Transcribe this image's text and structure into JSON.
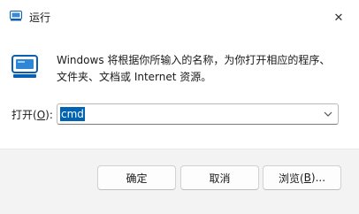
{
  "window": {
    "title": "运行",
    "icon": "run-dialog-icon"
  },
  "titlebar": {
    "close_glyph": "✕"
  },
  "content": {
    "description": "Windows 将根据你所输入的名称，为你打开相应的程序、文件夹、文档或 Internet 资源。",
    "open_label_prefix": "打开(",
    "open_label_key": "O",
    "open_label_suffix": "):",
    "command_value": "cmd"
  },
  "buttons": {
    "ok_label": "确定",
    "cancel_label": "取消",
    "browse_prefix": "浏览(",
    "browse_key": "B",
    "browse_suffix": ")..."
  },
  "colors": {
    "selection": "#0063b1",
    "footer_bg": "#f3f3f3",
    "icon_accent": "#0a5fb4"
  }
}
